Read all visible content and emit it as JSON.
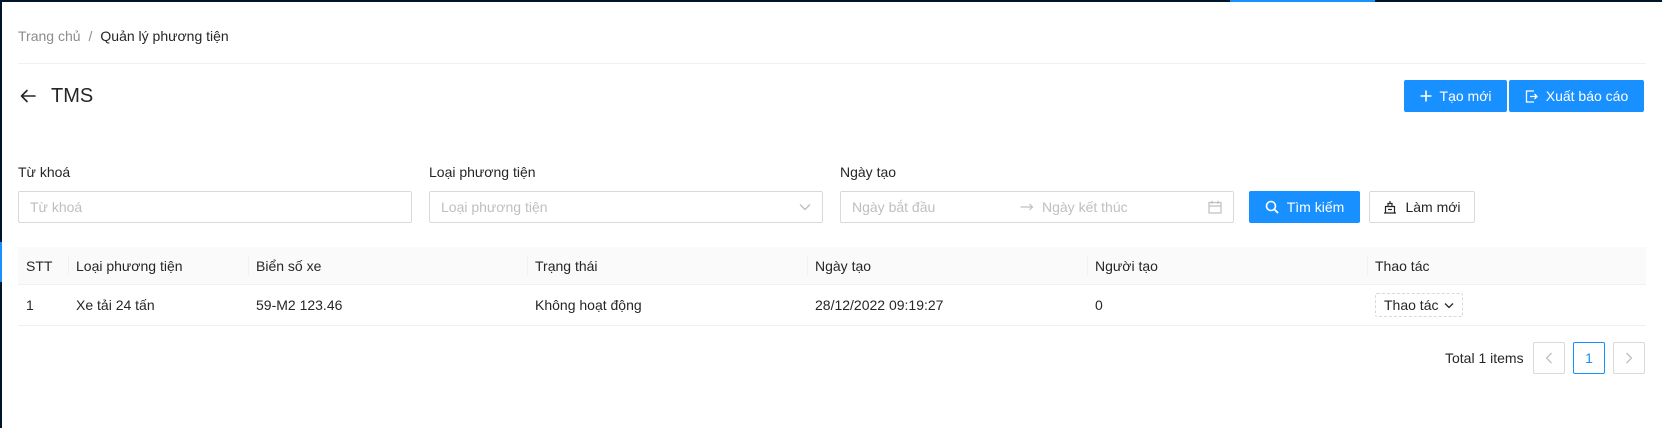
{
  "breadcrumb": {
    "home": "Trang chủ",
    "separator": "/",
    "current": "Quản lý phương tiện"
  },
  "header": {
    "title": "TMS",
    "create_label": "Tạo mới",
    "export_label": "Xuất báo cáo"
  },
  "filters": {
    "keyword_label": "Từ khoá",
    "keyword_placeholder": "Từ khoá",
    "vehicle_type_label": "Loại phương tiện",
    "vehicle_type_placeholder": "Loại phương tiện",
    "date_label": "Ngày tạo",
    "date_start_placeholder": "Ngày bắt đầu",
    "date_end_placeholder": "Ngày kết thúc",
    "search_label": "Tìm kiếm",
    "reset_label": "Làm mới"
  },
  "table": {
    "columns": [
      "STT",
      "Loại phương tiện",
      "Biển số xe",
      "Trạng thái",
      "Ngày tạo",
      "Người tạo",
      "Thao tác"
    ],
    "rows": [
      {
        "stt": "1",
        "type": "Xe tải 24 tấn",
        "plate": "59-M2 123.46",
        "status": "Không hoạt động",
        "created": "28/12/2022 09:19:27",
        "creator": "0",
        "action": "Thao tác"
      }
    ]
  },
  "pagination": {
    "total": "Total 1 items",
    "current_page": "1"
  },
  "colors": {
    "primary": "#1890ff",
    "sidebar": "#001529"
  }
}
